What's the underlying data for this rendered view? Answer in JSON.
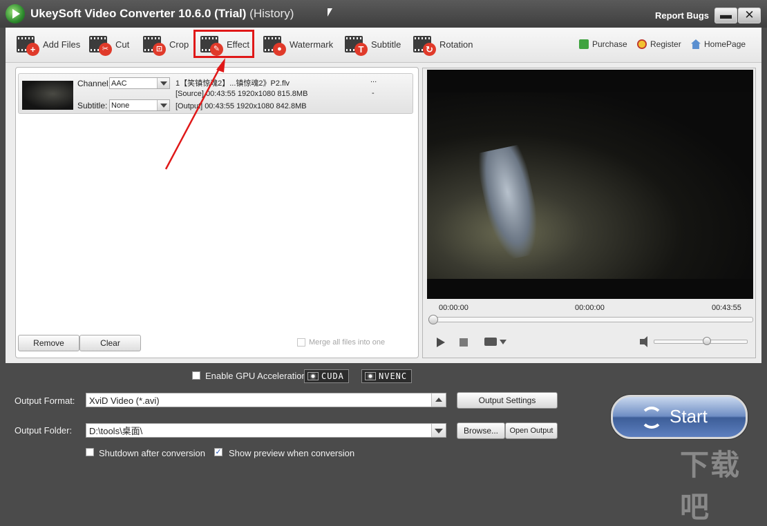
{
  "window": {
    "title": "UkeySoft Video Converter 10.6.0 (Trial)",
    "history": "(History)",
    "report_bugs": "Report Bugs",
    "minimize": "▬",
    "close": "✕"
  },
  "toolbar": {
    "add_files": "Add Files",
    "cut": "Cut",
    "crop": "Crop",
    "effect": "Effect",
    "watermark": "Watermark",
    "subtitle": "Subtitle",
    "rotation": "Rotation",
    "purchase": "Purchase",
    "register": "Register",
    "homepage": "HomePage"
  },
  "file_item": {
    "channel_label": "Channel:",
    "channel_value": "AAC",
    "subtitle_label": "Subtitle:",
    "subtitle_value": "None",
    "name": "1【笑镇惊魂2】...镇惊魂2》P2.flv",
    "more": "...",
    "source_line": "[Source]  00:43:55   1920x1080  815.8MB",
    "output_line": "[Output]  00:43:55   1920x1080  842.8MB",
    "dash": "-"
  },
  "file_panel": {
    "remove": "Remove",
    "clear": "Clear",
    "merge": "Merge all files into one"
  },
  "player": {
    "time_start": "00:00:00",
    "time_current": "00:00:00",
    "time_end": "00:43:55",
    "position": 0,
    "volume": 0.5
  },
  "bottom": {
    "gpu_label": "Enable GPU Acceleration",
    "gpu_checked": false,
    "cuda": "CUDA",
    "nvenc": "NVENC",
    "output_format_label": "Output Format:",
    "output_format_value": "XviD Video (*.avi)",
    "output_settings": "Output Settings",
    "output_folder_label": "Output Folder:",
    "output_folder_value": "D:\\tools\\桌面\\",
    "browse": "Browse...",
    "open_output": "Open Output",
    "shutdown_label": "Shutdown after conversion",
    "shutdown_checked": false,
    "preview_label": "Show preview when conversion",
    "preview_checked": true,
    "start": "Start"
  },
  "colors": {
    "highlight": "#e01818",
    "start_button": "#5d7fbf"
  }
}
